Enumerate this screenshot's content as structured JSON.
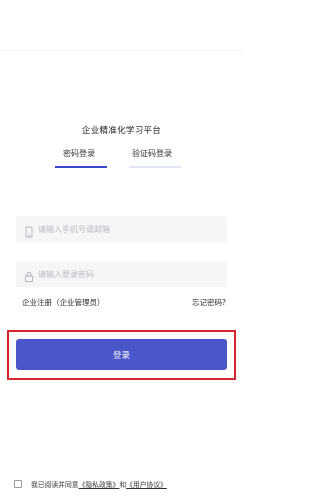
{
  "app": {
    "title": "企业精准化学习平台"
  },
  "tabs": {
    "password_login": "密码登录",
    "code_login": "验证码登录"
  },
  "phone_field": {
    "placeholder": "请输入手机号或邮箱",
    "value": "",
    "icon": "phone-icon"
  },
  "password_field": {
    "placeholder": "请输入登录密码",
    "value": "",
    "icon": "lock-icon"
  },
  "links": {
    "register": "企业注册（企业管理员）",
    "forgot_password": "忘记密码?"
  },
  "login_button": {
    "label": "登录"
  },
  "agreement": {
    "prefix": "我已阅读并同意",
    "privacy": "《隐私政策》",
    "connector": "和",
    "terms": "《用户协议》"
  },
  "colors": {
    "primary": "#4a56c9",
    "highlight": "#d7262f",
    "field_bg": "#f6f6f8"
  }
}
